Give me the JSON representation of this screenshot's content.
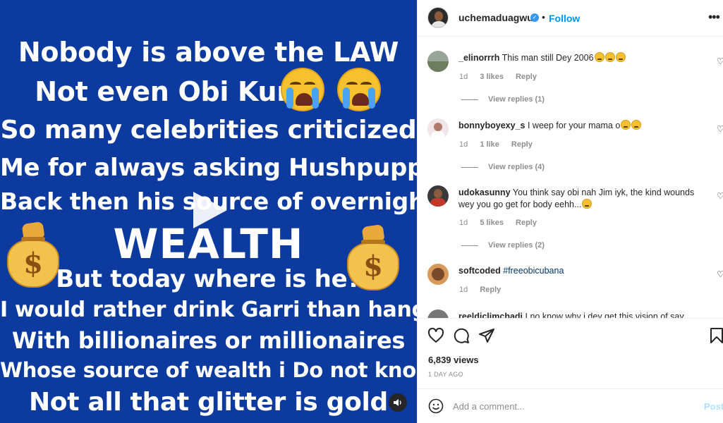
{
  "post": {
    "lines": [
      "Nobody is above the LAW",
      "Not even Obi Kunu",
      "So many celebrities criticized",
      "Me for always asking Hushpuppi",
      "Back then his source of overnight",
      "WEALTH",
      "But today where is he?",
      "I would rather drink Garri than hang out",
      "With billionaires or millionaires",
      "Whose source of wealth i Do not know",
      "Not all that glitter is gold"
    ],
    "money_symbol": "$",
    "background_color": "#0d3a9e"
  },
  "header": {
    "username": "uchemaduagwu",
    "verified_mark": "✓",
    "separator": "•",
    "follow_label": "Follow",
    "more_label": "•••"
  },
  "comments": [
    {
      "username": "_elinorrrh",
      "text": "This man still Dey 2006",
      "age": "1d",
      "likes": "3 likes",
      "reply_label": "Reply",
      "view_replies": "View replies (1)"
    },
    {
      "username": "bonnyboyexy_s",
      "text": "I weep for your mama o",
      "age": "1d",
      "likes": "1 like",
      "reply_label": "Reply",
      "view_replies": "View replies (4)"
    },
    {
      "username": "udokasunny",
      "text": "You think say obi nah Jim iyk, the kind wounds wey you go get for body eehh...",
      "age": "1d",
      "likes": "5 likes",
      "reply_label": "Reply",
      "view_replies": "View replies (2)"
    },
    {
      "username": "softcoded",
      "tag": "#freeobicubana",
      "age": "1d",
      "reply_label": "Reply"
    },
    {
      "username": "reeldiclimchadi",
      "text": "I no know why i dey get this vision of say"
    }
  ],
  "stats": {
    "views": "6,839 views",
    "time": "1 DAY AGO"
  },
  "composer": {
    "placeholder": "Add a comment...",
    "post_label": "Post"
  },
  "colors": {
    "accent": "#0095f6",
    "post_disabled": "#b2dffc",
    "muted": "#8e8e8e"
  }
}
